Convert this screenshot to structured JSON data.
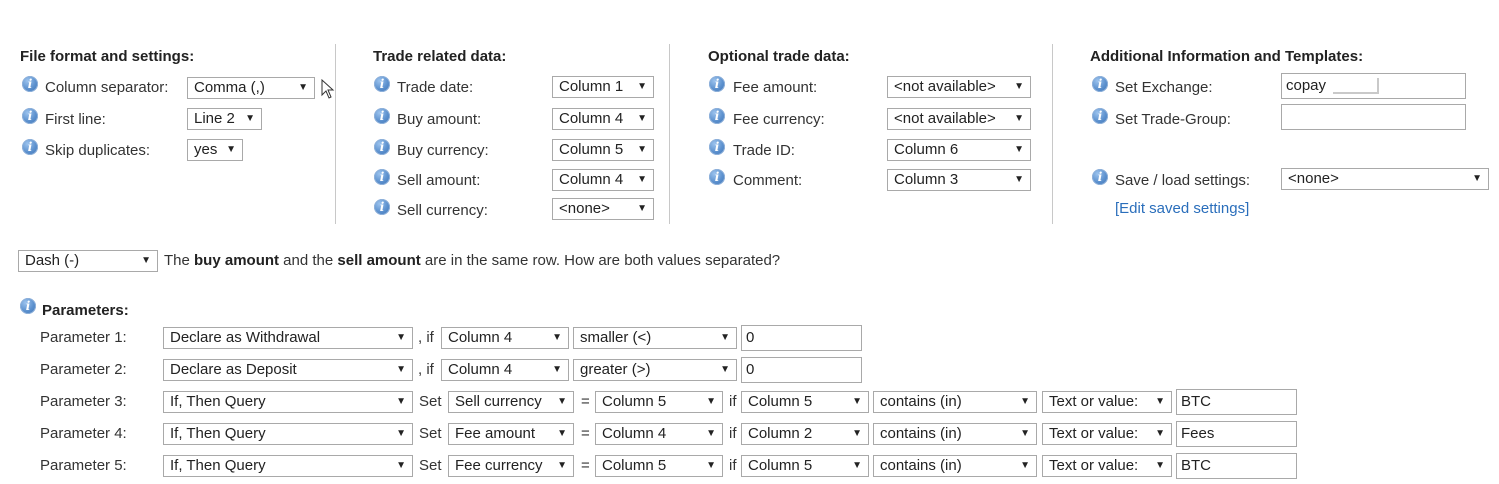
{
  "file_format": {
    "heading": "File format and settings:",
    "column_separator": {
      "label": "Column separator:",
      "value": "Comma (,)"
    },
    "first_line": {
      "label": "First line:",
      "value": "Line 2"
    },
    "skip_duplicates": {
      "label": "Skip duplicates:",
      "value": "yes"
    }
  },
  "trade_data": {
    "heading": "Trade related data:",
    "fields": [
      {
        "label": "Trade date:",
        "value": "Column 1"
      },
      {
        "label": "Buy amount:",
        "value": "Column 4"
      },
      {
        "label": "Buy currency:",
        "value": "Column 5"
      },
      {
        "label": "Sell amount:",
        "value": "Column 4"
      },
      {
        "label": "Sell currency:",
        "value": "<none>"
      }
    ]
  },
  "optional_data": {
    "heading": "Optional trade data:",
    "fields": [
      {
        "label": "Fee amount:",
        "value": "<not available>"
      },
      {
        "label": "Fee currency:",
        "value": "<not available>"
      },
      {
        "label": "Trade ID:",
        "value": "Column 6"
      },
      {
        "label": "Comment:",
        "value": "Column 3"
      }
    ]
  },
  "additional": {
    "heading": "Additional Information and Templates:",
    "exchange": {
      "label": "Set Exchange:",
      "value": "copay"
    },
    "trade_group": {
      "label": "Set Trade-Group:",
      "value": ""
    },
    "save_load": {
      "label": "Save / load settings:",
      "value": "<none>"
    },
    "edit_link": "[Edit saved settings]"
  },
  "separator_row": {
    "value": "Dash (-)",
    "text_pre": "The ",
    "bold1": "buy amount",
    "text_mid": " and the ",
    "bold2": "sell amount",
    "text_post": " are in the same row. How are both values separated?"
  },
  "parameters": {
    "heading": "Parameters:",
    "if_word": ", if",
    "set_word": "Set",
    "eq_word": "=",
    "if_word2": "if",
    "rows": [
      {
        "label": "Parameter 1:",
        "action": "Declare as Withdrawal",
        "column": "Column 4",
        "op": "smaller (<)",
        "value": "0"
      },
      {
        "label": "Parameter 2:",
        "action": "Declare as Deposit",
        "column": "Column 4",
        "op": "greater (>)",
        "value": "0"
      },
      {
        "label": "Parameter 3:",
        "action": "If, Then Query",
        "set": "Sell currency",
        "eq": "Column 5",
        "if_col": "Column 5",
        "op": "contains (in)",
        "type": "Text or value:",
        "value": "BTC"
      },
      {
        "label": "Parameter 4:",
        "action": "If, Then Query",
        "set": "Fee amount",
        "eq": "Column 4",
        "if_col": "Column 2",
        "op": "contains (in)",
        "type": "Text or value:",
        "value": "Fees"
      },
      {
        "label": "Parameter 5:",
        "action": "If, Then Query",
        "set": "Fee currency",
        "eq": "Column 5",
        "if_col": "Column 5",
        "op": "contains (in)",
        "type": "Text or value:",
        "value": "BTC"
      }
    ]
  },
  "icons": {
    "info": "i",
    "dropdown_arrow": "▼"
  }
}
